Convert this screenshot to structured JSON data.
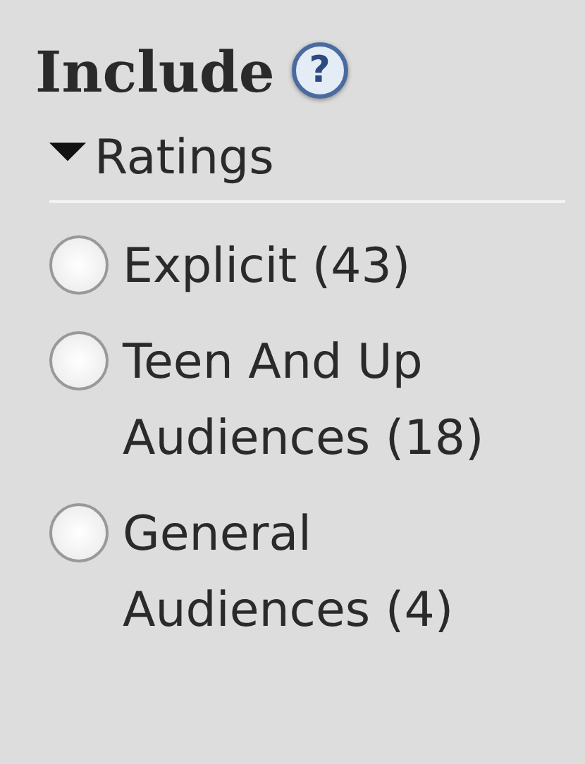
{
  "heading": {
    "title": "Include",
    "help": "?"
  },
  "section": {
    "title": "Ratings",
    "expanded": true,
    "options": [
      {
        "label": "Explicit (43)",
        "selected": false
      },
      {
        "label": "Teen And Up Audiences (18)",
        "selected": false
      },
      {
        "label": "General Audiences (4)",
        "selected": false
      }
    ]
  }
}
